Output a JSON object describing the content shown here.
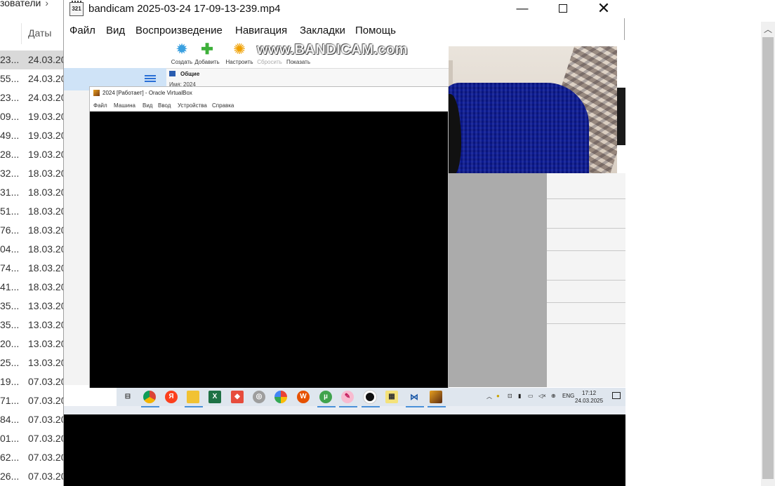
{
  "explorer": {
    "breadcrumb": "зователи",
    "column_dates": "Даты",
    "rows": [
      {
        "a": "23...",
        "b": "24.03.20"
      },
      {
        "a": "55...",
        "b": "24.03.20"
      },
      {
        "a": "23...",
        "b": "24.03.20"
      },
      {
        "a": "09...",
        "b": "19.03.20"
      },
      {
        "a": "49...",
        "b": "19.03.20"
      },
      {
        "a": "28...",
        "b": "19.03.20"
      },
      {
        "a": "32...",
        "b": "18.03.20"
      },
      {
        "a": "31...",
        "b": "18.03.20"
      },
      {
        "a": "51...",
        "b": "18.03.20"
      },
      {
        "a": "76...",
        "b": "18.03.20"
      },
      {
        "a": "04...",
        "b": "18.03.20"
      },
      {
        "a": "74...",
        "b": "18.03.20"
      },
      {
        "a": "41...",
        "b": "18.03.20"
      },
      {
        "a": "35...",
        "b": "13.03.20"
      },
      {
        "a": "35...",
        "b": "13.03.20"
      },
      {
        "a": "20...",
        "b": "13.03.20"
      },
      {
        "a": "25...",
        "b": "13.03.20"
      },
      {
        "a": "19...",
        "b": "07.03.20"
      },
      {
        "a": "71...",
        "b": "07.03.20"
      },
      {
        "a": "84...",
        "b": "07.03.20"
      },
      {
        "a": "01...",
        "b": "07.03.20"
      },
      {
        "a": "62...",
        "b": "07.03.20"
      },
      {
        "a": "26...",
        "b": "07.03.20"
      }
    ]
  },
  "player": {
    "title": "bandicam 2025-03-24 17-09-13-239.mp4",
    "menu": [
      "Файл",
      "Вид",
      "Воспроизведение",
      "Навигация",
      "Закладки",
      "Помощь"
    ]
  },
  "video": {
    "watermark": "www.BANDICAM.com",
    "toolbar": [
      {
        "label": "Создать",
        "icon": "gear-icon",
        "color": "#3aa0e0"
      },
      {
        "label": "Добавить",
        "icon": "plus-icon",
        "color": "#3db03a"
      },
      {
        "label": "Настроить",
        "icon": "settings-icon",
        "color": "#f0a000"
      },
      {
        "label": "Сбросить",
        "icon": "reset-icon",
        "color": "#999999"
      },
      {
        "label": "Показать",
        "icon": "show-icon",
        "color": "#2a7ad0"
      }
    ],
    "details_header": "Общие",
    "details_name": "Имя:  2024",
    "vbox_title": "2024 [Работает] - Oracle VirtualBox",
    "vbox_menu": [
      "Файл",
      "Машина",
      "Вид",
      "Ввод",
      "Устройства",
      "Справка"
    ],
    "tray_lang": "ENG",
    "clock_time": "17:12",
    "clock_date": "24.03.2025"
  }
}
